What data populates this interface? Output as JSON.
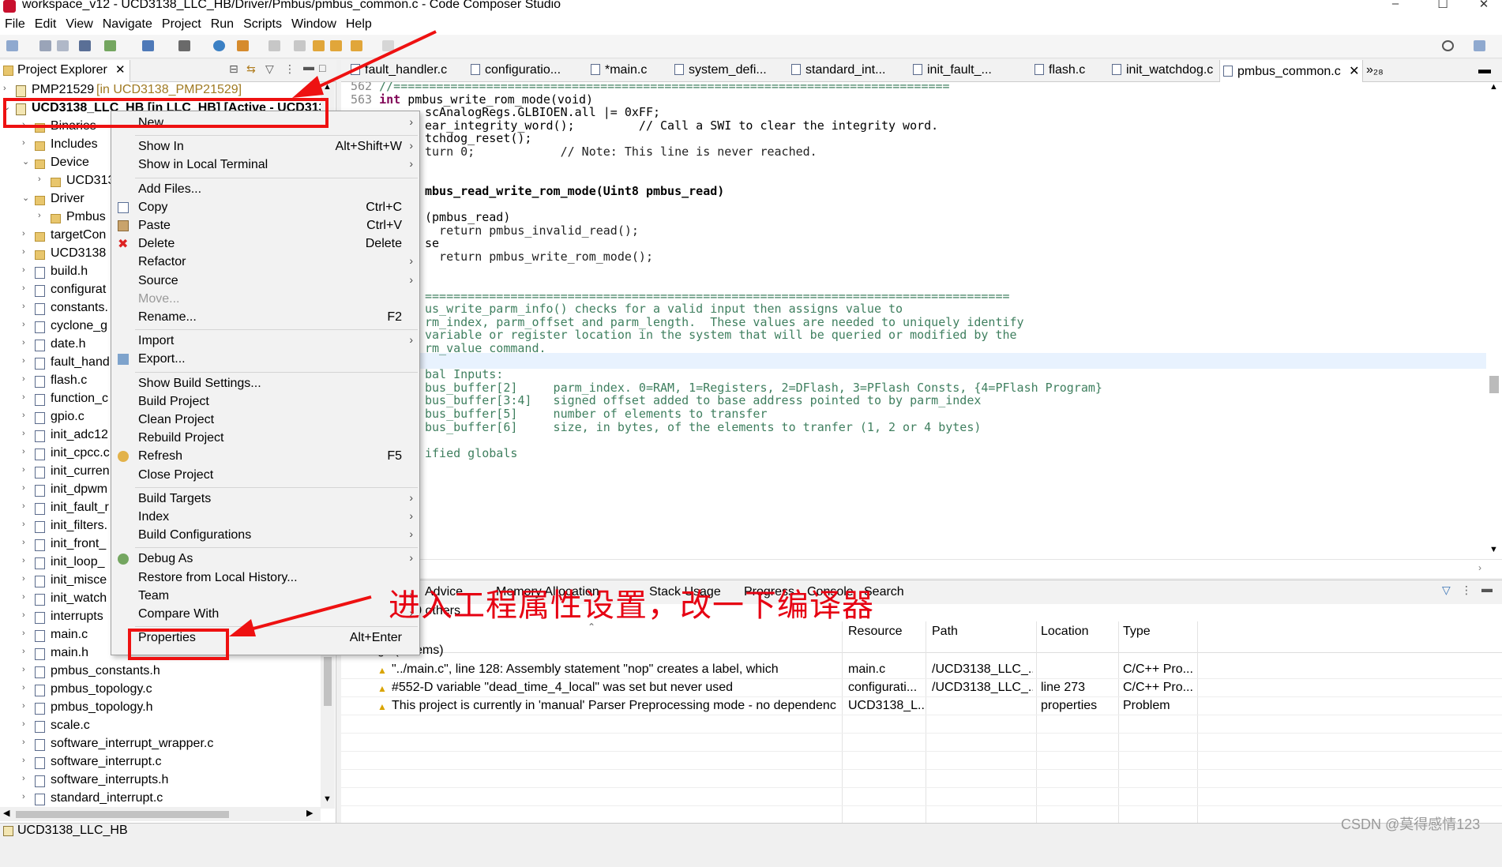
{
  "window": {
    "title": "workspace_v12 - UCD3138_LLC_HB/Driver/Pmbus/pmbus_common.c - Code Composer Studio",
    "minimize": "–",
    "maximize": "☐",
    "close": "✕"
  },
  "menubar": [
    "File",
    "Edit",
    "View",
    "Navigate",
    "Project",
    "Run",
    "Scripts",
    "Window",
    "Help"
  ],
  "explorer": {
    "tab_label": "Project Explorer",
    "tree": [
      {
        "label": "PMP21529",
        "suffix": " [in UCD3138_PMP21529]",
        "depth": 0,
        "type": "proj"
      },
      {
        "label": "UCD3138_LLC_HB [in LLC_HB] [Active - UCD313",
        "suffix": "",
        "depth": 0,
        "type": "proj"
      },
      {
        "label": "Binaries",
        "suffix": "",
        "depth": 1,
        "type": "folder"
      },
      {
        "label": "Includes",
        "suffix": "",
        "depth": 1,
        "type": "folder"
      },
      {
        "label": "Device",
        "suffix": "",
        "depth": 1,
        "type": "folder"
      },
      {
        "label": "UCD313",
        "suffix": "",
        "depth": 2,
        "type": "folder"
      },
      {
        "label": "Driver",
        "suffix": "",
        "depth": 1,
        "type": "folder"
      },
      {
        "label": "Pmbus",
        "suffix": "",
        "depth": 2,
        "type": "folder"
      },
      {
        "label": "targetCon",
        "suffix": "",
        "depth": 1,
        "type": "folder"
      },
      {
        "label": "UCD3138",
        "suffix": "",
        "depth": 1,
        "type": "folder"
      },
      {
        "label": "build.h",
        "suffix": "",
        "depth": 1,
        "type": "file"
      },
      {
        "label": "configurat",
        "suffix": "",
        "depth": 1,
        "type": "file"
      },
      {
        "label": "constants.",
        "suffix": "",
        "depth": 1,
        "type": "file"
      },
      {
        "label": "cyclone_g",
        "suffix": "",
        "depth": 1,
        "type": "file"
      },
      {
        "label": "date.h",
        "suffix": "",
        "depth": 1,
        "type": "file"
      },
      {
        "label": "fault_hand",
        "suffix": "",
        "depth": 1,
        "type": "file"
      },
      {
        "label": "flash.c",
        "suffix": "",
        "depth": 1,
        "type": "file"
      },
      {
        "label": "function_c",
        "suffix": "",
        "depth": 1,
        "type": "file"
      },
      {
        "label": "gpio.c",
        "suffix": "",
        "depth": 1,
        "type": "file"
      },
      {
        "label": "init_adc12",
        "suffix": "",
        "depth": 1,
        "type": "file"
      },
      {
        "label": "init_cpcc.c",
        "suffix": "",
        "depth": 1,
        "type": "file"
      },
      {
        "label": "init_curren",
        "suffix": "",
        "depth": 1,
        "type": "file"
      },
      {
        "label": "init_dpwm",
        "suffix": "",
        "depth": 1,
        "type": "file"
      },
      {
        "label": "init_fault_r",
        "suffix": "",
        "depth": 1,
        "type": "file"
      },
      {
        "label": "init_filters.",
        "suffix": "",
        "depth": 1,
        "type": "file"
      },
      {
        "label": "init_front_",
        "suffix": "",
        "depth": 1,
        "type": "file"
      },
      {
        "label": "init_loop_",
        "suffix": "",
        "depth": 1,
        "type": "file"
      },
      {
        "label": "init_misce",
        "suffix": "",
        "depth": 1,
        "type": "file"
      },
      {
        "label": "init_watch",
        "suffix": "",
        "depth": 1,
        "type": "file"
      },
      {
        "label": "interrupts",
        "suffix": "",
        "depth": 1,
        "type": "file"
      },
      {
        "label": "main.c",
        "suffix": "",
        "depth": 1,
        "type": "file"
      },
      {
        "label": "main.h",
        "suffix": "",
        "depth": 1,
        "type": "file"
      },
      {
        "label": "pmbus_constants.h",
        "suffix": "",
        "depth": 1,
        "type": "file"
      },
      {
        "label": "pmbus_topology.c",
        "suffix": "",
        "depth": 1,
        "type": "file"
      },
      {
        "label": "pmbus_topology.h",
        "suffix": "",
        "depth": 1,
        "type": "file"
      },
      {
        "label": "scale.c",
        "suffix": "",
        "depth": 1,
        "type": "file"
      },
      {
        "label": "software_interrupt_wrapper.c",
        "suffix": "",
        "depth": 1,
        "type": "file"
      },
      {
        "label": "software_interrupt.c",
        "suffix": "",
        "depth": 1,
        "type": "file"
      },
      {
        "label": "software_interrupts.h",
        "suffix": "",
        "depth": 1,
        "type": "file"
      },
      {
        "label": "standard_interrupt.c",
        "suffix": "",
        "depth": 1,
        "type": "file"
      }
    ]
  },
  "editor_tabs": [
    {
      "label": "fault_handler.c",
      "active": false
    },
    {
      "label": "configuratio...",
      "active": false
    },
    {
      "label": "*main.c",
      "active": false
    },
    {
      "label": "system_defi...",
      "active": false
    },
    {
      "label": "standard_int...",
      "active": false
    },
    {
      "label": "init_fault_...",
      "active": false
    },
    {
      "label": "flash.c",
      "active": false
    },
    {
      "label": "init_watchdog.c",
      "active": false
    },
    {
      "label": "pmbus_common.c",
      "active": true
    },
    {
      "label": "»₂₈",
      "active": false
    }
  ],
  "code_lines": [
    {
      "ln": "562",
      "text": "//=============================================================================="
    },
    {
      "ln": "563",
      "kw": "int",
      "text": " pmbus_write_rom_mode(void)"
    },
    {
      "ln": "",
      "text": "scAnalogRegs.GLBIOEN.all |= 0xFF;"
    },
    {
      "ln": "",
      "text": "ear_integrity_word();         // Call a SWI to clear the integrity word."
    },
    {
      "ln": "",
      "text": "tchdog_reset();"
    },
    {
      "ln": "",
      "text": "turn 0;            // Note: This line is never reached."
    },
    {
      "ln": "",
      "text": ""
    },
    {
      "ln": "",
      "text": ""
    },
    {
      "ln": "",
      "text": "mbus_read_write_rom_mode(Uint8 pmbus_read)"
    },
    {
      "ln": "",
      "text": ""
    },
    {
      "ln": "",
      "text": "(pmbus_read)"
    },
    {
      "ln": "",
      "text": "  return pmbus_invalid_read();"
    },
    {
      "ln": "",
      "text": "se"
    },
    {
      "ln": "",
      "text": "  return pmbus_write_rom_mode();"
    },
    {
      "ln": "",
      "text": ""
    },
    {
      "ln": "",
      "text": ""
    },
    {
      "ln": "",
      "text": "=================================================================================="
    },
    {
      "ln": "",
      "text": "us_write_parm_info() checks for a valid input then assigns value to"
    },
    {
      "ln": "",
      "text": "rm_index, parm_offset and parm_length.  These values are needed to uniquely identify"
    },
    {
      "ln": "",
      "text": "variable or register location in the system that will be queried or modified by the"
    },
    {
      "ln": "",
      "text": "rm_value command."
    },
    {
      "ln": "",
      "text": ""
    },
    {
      "ln": "",
      "text": "bal Inputs:"
    },
    {
      "ln": "",
      "text": "bus_buffer[2]     parm_index. 0=RAM, 1=Registers, 2=DFlash, 3=PFlash Consts, {4=PFlash Program}"
    },
    {
      "ln": "",
      "text": "bus_buffer[3:4]   signed offset added to base address pointed to by parm_index"
    },
    {
      "ln": "",
      "text": "bus_buffer[5]     number of elements to transfer"
    },
    {
      "ln": "",
      "text": "bus_buffer[6]     size, in bytes, of the elements to tranfer (1, 2 or 4 bytes)"
    },
    {
      "ln": "",
      "text": ""
    },
    {
      "ln": "",
      "text": "ified globals"
    }
  ],
  "bottom_panel": {
    "tabs": [
      "Advice",
      "Memory Allocation",
      "Stack Usage",
      "Progress",
      "Console",
      "Search"
    ],
    "summary": "nings, 0 others",
    "group_label": "gs (3 items)",
    "columns": [
      "Resource",
      "Path",
      "Location",
      "Type"
    ],
    "rows": [
      {
        "desc": "\"../main.c\", line 128: Assembly statement \"nop\" creates a label, which",
        "resource": "main.c",
        "path": "/UCD3138_LLC_...",
        "location": "",
        "type": "C/C++ Pro..."
      },
      {
        "desc": "#552-D variable \"dead_time_4_local\" was set but never used",
        "resource": "configurati...",
        "path": "/UCD3138_LLC_...",
        "location": "line 273",
        "type": "C/C++ Pro..."
      },
      {
        "desc": "This project is currently in 'manual' Parser Preprocessing mode - no dependenc",
        "resource": "UCD3138_L...",
        "path": "",
        "location": "properties",
        "type": "Problem"
      }
    ]
  },
  "context_menu": [
    {
      "label": "New",
      "shortcut": "",
      "submenu": true,
      "icon": "",
      "disabled": false
    },
    {
      "sep": true
    },
    {
      "label": "Show In",
      "shortcut": "Alt+Shift+W",
      "submenu": true,
      "icon": "",
      "disabled": false
    },
    {
      "label": "Show in Local Terminal",
      "shortcut": "",
      "submenu": true,
      "icon": "",
      "disabled": false
    },
    {
      "sep": true
    },
    {
      "label": "Add Files...",
      "shortcut": "",
      "submenu": false,
      "icon": "",
      "disabled": false
    },
    {
      "label": "Copy",
      "shortcut": "Ctrl+C",
      "submenu": false,
      "icon": "copy-icon",
      "disabled": false
    },
    {
      "label": "Paste",
      "shortcut": "Ctrl+V",
      "submenu": false,
      "icon": "paste-icon",
      "disabled": false
    },
    {
      "label": "Delete",
      "shortcut": "Delete",
      "submenu": false,
      "icon": "delete-icon",
      "disabled": false
    },
    {
      "label": "Refactor",
      "shortcut": "",
      "submenu": true,
      "icon": "",
      "disabled": false
    },
    {
      "label": "Source",
      "shortcut": "",
      "submenu": true,
      "icon": "",
      "disabled": false
    },
    {
      "label": "Move...",
      "shortcut": "",
      "submenu": false,
      "icon": "",
      "disabled": true
    },
    {
      "label": "Rename...",
      "shortcut": "F2",
      "submenu": false,
      "icon": "",
      "disabled": false
    },
    {
      "sep": true
    },
    {
      "label": "Import",
      "shortcut": "",
      "submenu": true,
      "icon": "",
      "disabled": false
    },
    {
      "label": "Export...",
      "shortcut": "",
      "submenu": false,
      "icon": "export-icon",
      "disabled": false
    },
    {
      "sep": true
    },
    {
      "label": "Show Build Settings...",
      "shortcut": "",
      "submenu": false,
      "icon": "",
      "disabled": false
    },
    {
      "label": "Build Project",
      "shortcut": "",
      "submenu": false,
      "icon": "",
      "disabled": false
    },
    {
      "label": "Clean Project",
      "shortcut": "",
      "submenu": false,
      "icon": "",
      "disabled": false
    },
    {
      "label": "Rebuild Project",
      "shortcut": "",
      "submenu": false,
      "icon": "",
      "disabled": false
    },
    {
      "label": "Refresh",
      "shortcut": "F5",
      "submenu": false,
      "icon": "refresh-icon",
      "disabled": false
    },
    {
      "label": "Close Project",
      "shortcut": "",
      "submenu": false,
      "icon": "",
      "disabled": false
    },
    {
      "sep": true
    },
    {
      "label": "Build Targets",
      "shortcut": "",
      "submenu": true,
      "icon": "",
      "disabled": false
    },
    {
      "label": "Index",
      "shortcut": "",
      "submenu": true,
      "icon": "",
      "disabled": false
    },
    {
      "label": "Build Configurations",
      "shortcut": "",
      "submenu": true,
      "icon": "",
      "disabled": false
    },
    {
      "sep": true
    },
    {
      "label": "Debug As",
      "shortcut": "",
      "submenu": true,
      "icon": "debug-icon",
      "disabled": false
    },
    {
      "label": "Restore from Local History...",
      "shortcut": "",
      "submenu": false,
      "icon": "",
      "disabled": false
    },
    {
      "label": "Team",
      "shortcut": "",
      "submenu": true,
      "icon": "",
      "disabled": false
    },
    {
      "label": "Compare With",
      "shortcut": "",
      "submenu": true,
      "icon": "",
      "disabled": false
    },
    {
      "sep": true
    },
    {
      "label": "Properties",
      "shortcut": "Alt+Enter",
      "submenu": false,
      "icon": "",
      "disabled": false
    }
  ],
  "annotation_text": "进入工程属性设置，改一下编译器",
  "status": {
    "text": "UCD3138_LLC_HB"
  },
  "watermark": "CSDN @莫得感情123",
  "colors": {
    "annotation_red": "#e11111",
    "keyword": "#7f0055",
    "comment": "#3f7f5f"
  }
}
